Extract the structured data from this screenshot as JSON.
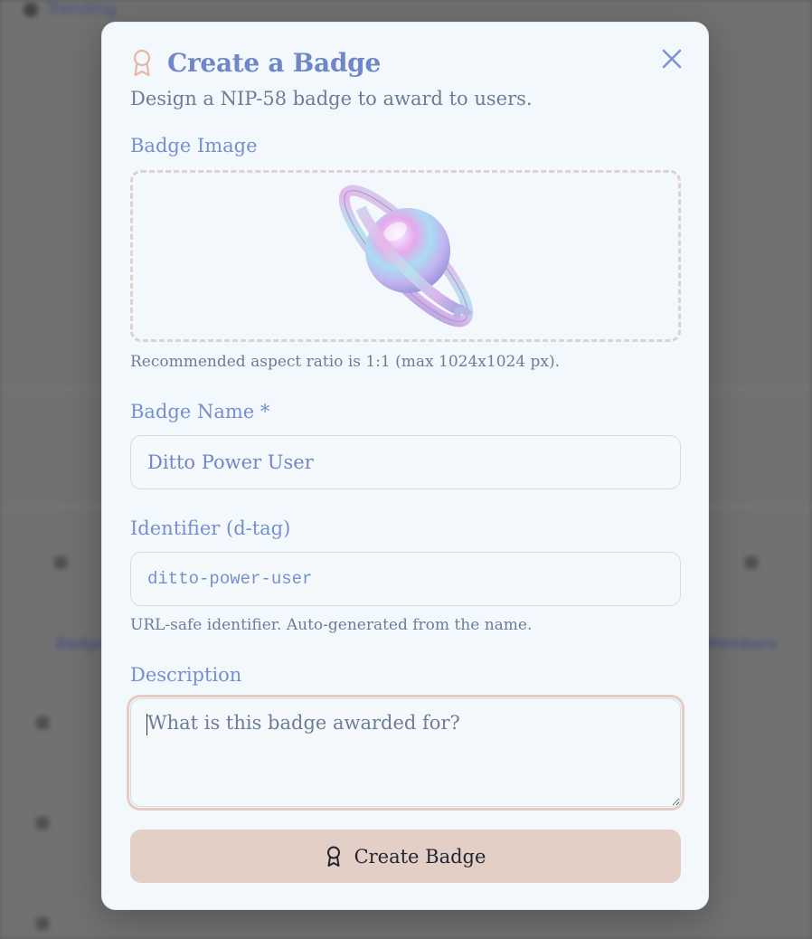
{
  "background": {
    "breadcrumb": "Trending",
    "section_label": "Badges",
    "side_label": "Members"
  },
  "modal": {
    "title": "Create a Badge",
    "title_icon": "award-ribbon-icon",
    "close_icon": "close-icon",
    "subtitle": "Design a NIP-58 badge to award to users."
  },
  "badge_image": {
    "label": "Badge Image",
    "image_alt": "planet-with-rings",
    "hint": "Recommended aspect ratio is 1:1 (max 1024x1024 px)."
  },
  "badge_name": {
    "label": "Badge Name *",
    "value": "Ditto Power User"
  },
  "identifier": {
    "label": "Identifier (d-tag)",
    "value": "ditto-power-user",
    "hint": "URL-safe identifier. Auto-generated from the name."
  },
  "description": {
    "label": "Description",
    "placeholder": "What is this badge awarded for?",
    "value": ""
  },
  "submit": {
    "label": "Create Badge",
    "icon": "award-ribbon-icon"
  },
  "colors": {
    "accent": "#6f86c8",
    "modal_bg": "#f3f8fc",
    "button_bg": "#e4cfc6",
    "icon_peach": "#e8b7a3"
  }
}
